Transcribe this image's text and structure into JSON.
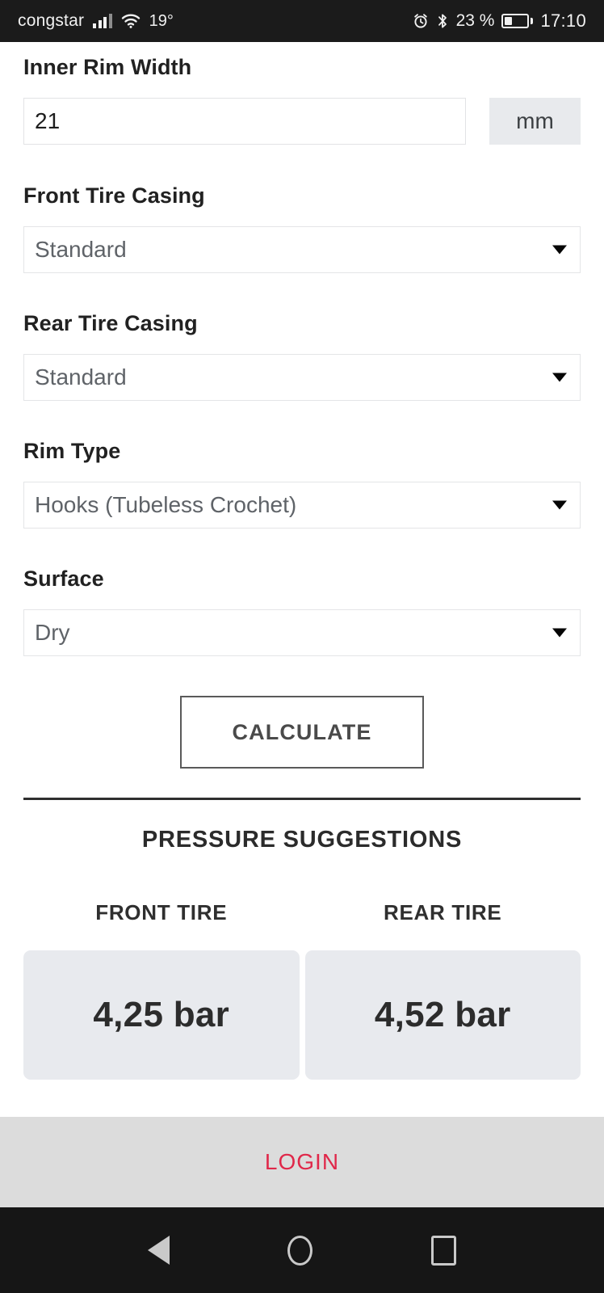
{
  "status_bar": {
    "carrier": "congstar",
    "temperature": "19°",
    "battery_percent": "23 %",
    "time": "17:10",
    "icons": [
      "signal-bars-icon",
      "wifi-icon",
      "alarm-icon",
      "bluetooth-icon",
      "battery-icon"
    ],
    "battery_level": 33
  },
  "form": {
    "inner_rim_width": {
      "label": "Inner Rim Width",
      "value": "21",
      "placeholder": "Inner Rim Width",
      "unit": "mm"
    },
    "front_tire_casing": {
      "label": "Front Tire Casing",
      "value": "Standard"
    },
    "rear_tire_casing": {
      "label": "Rear Tire Casing",
      "value": "Standard"
    },
    "rim_type": {
      "label": "Rim Type",
      "value": "Hooks (Tubeless Crochet)"
    },
    "surface": {
      "label": "Surface",
      "value": "Dry"
    },
    "calculate_label": "CALCULATE"
  },
  "results": {
    "title": "PRESSURE SUGGESTIONS",
    "columns": [
      {
        "header": "FRONT TIRE",
        "value": "4,25 bar"
      },
      {
        "header": "REAR TIRE",
        "value": "4,52 bar"
      }
    ]
  },
  "bottom_bar": {
    "login_label": "LOGIN",
    "background": "#dcdcdc",
    "accent": "#e0284a"
  },
  "nav_bar": {
    "back": "back-triangle-icon",
    "home": "home-circle-icon",
    "recents": "recents-square-icon"
  }
}
